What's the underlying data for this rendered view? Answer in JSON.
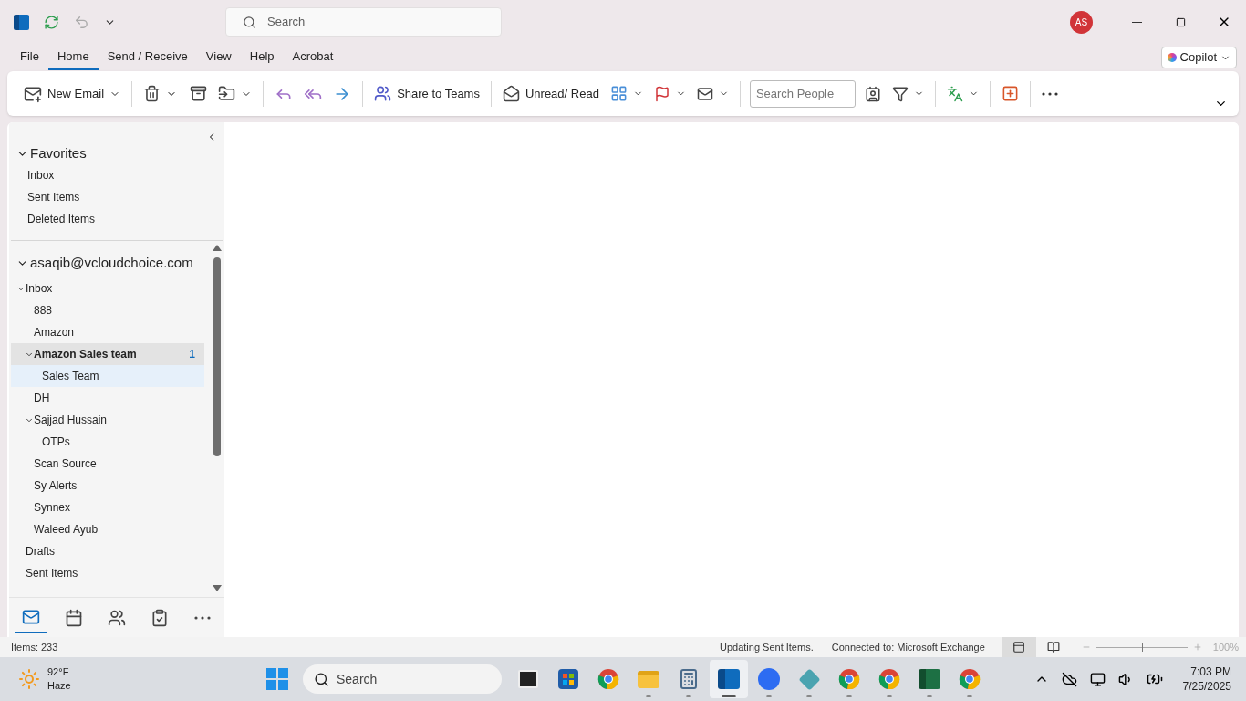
{
  "title_bar": {
    "search": {
      "placeholder": "Search"
    },
    "avatar": "AS"
  },
  "menu_tabs": [
    {
      "label": "File",
      "selected": false
    },
    {
      "label": "Home",
      "selected": true
    },
    {
      "label": "Send / Receive",
      "selected": false
    },
    {
      "label": "View",
      "selected": false
    },
    {
      "label": "Help",
      "selected": false
    },
    {
      "label": "Acrobat",
      "selected": false
    }
  ],
  "copilot": {
    "label": "Copilot"
  },
  "ribbon": {
    "new_email": "New Email",
    "share_to_teams": "Share to Teams",
    "unread_read": "Unread/ Read",
    "search_people": {
      "placeholder": "Search People"
    }
  },
  "favorites": {
    "label": "Favorites",
    "expanded": true,
    "items": [
      {
        "name": "Inbox",
        "selected": false
      },
      {
        "name": "Sent Items",
        "selected": false
      },
      {
        "name": "Deleted Items",
        "selected": false
      }
    ]
  },
  "account": {
    "label": "asaqib@vcloudchoice.com",
    "expanded": true,
    "folders": [
      {
        "name": "Inbox",
        "expanded": true,
        "selected": false,
        "hovered": false,
        "children": [
          {
            "name": "888",
            "selected": false,
            "hovered": false
          },
          {
            "name": "Amazon",
            "selected": false,
            "hovered": false
          },
          {
            "name": "Amazon Sales team",
            "expanded": true,
            "selected": true,
            "hovered": false,
            "unread": "1",
            "children": [
              {
                "name": "Sales Team",
                "selected": false,
                "hovered": true
              }
            ]
          },
          {
            "name": "DH",
            "selected": false,
            "hovered": false
          },
          {
            "name": "Sajjad Hussain",
            "expanded": true,
            "selected": false,
            "hovered": false,
            "children": [
              {
                "name": "OTPs",
                "selected": false,
                "hovered": false
              }
            ]
          },
          {
            "name": "Scan Source",
            "selected": false,
            "hovered": false
          },
          {
            "name": "Sy Alerts",
            "selected": false,
            "hovered": false
          },
          {
            "name": "Synnex",
            "selected": false,
            "hovered": false
          },
          {
            "name": "Waleed Ayub",
            "selected": false,
            "hovered": false
          }
        ]
      },
      {
        "name": "Drafts",
        "selected": false,
        "hovered": false
      },
      {
        "name": "Sent Items",
        "selected": false,
        "hovered": false
      }
    ]
  },
  "nav_modules": [
    {
      "kind": "mail",
      "selected": true
    },
    {
      "kind": "calendar",
      "selected": false
    },
    {
      "kind": "people",
      "selected": false
    },
    {
      "kind": "tasks",
      "selected": false
    },
    {
      "kind": "more",
      "selected": false
    }
  ],
  "status_bar": {
    "items": "Items: 233",
    "sync": "Updating Sent Items.",
    "connection": "Connected to: Microsoft Exchange",
    "views": [
      {
        "kind": "normal",
        "selected": true
      },
      {
        "kind": "reading",
        "selected": false
      }
    ],
    "zoom": {
      "level": 0.5,
      "reading": "100%"
    }
  },
  "taskbar": {
    "weather": {
      "temp": "92°F",
      "condition": "Haze"
    },
    "search": {
      "placeholder": "Search"
    },
    "apps": [
      {
        "kind": "taskview",
        "running": false,
        "selected": false
      },
      {
        "kind": "store",
        "running": false,
        "selected": false
      },
      {
        "kind": "chrome",
        "running": false,
        "selected": false
      },
      {
        "kind": "explorer",
        "running": true,
        "selected": false
      },
      {
        "kind": "calculator",
        "running": true,
        "selected": false
      },
      {
        "kind": "outlook",
        "running": true,
        "selected": true
      },
      {
        "kind": "zoom",
        "running": true,
        "selected": false
      },
      {
        "kind": "diamond",
        "running": true,
        "selected": false
      },
      {
        "kind": "chrome",
        "running": true,
        "selected": false
      },
      {
        "kind": "chrome",
        "running": true,
        "selected": false
      },
      {
        "kind": "excel",
        "running": true,
        "selected": false
      },
      {
        "kind": "chrome",
        "running": true,
        "selected": false
      }
    ],
    "time": "7:03 PM",
    "date": "7/25/2025"
  }
}
